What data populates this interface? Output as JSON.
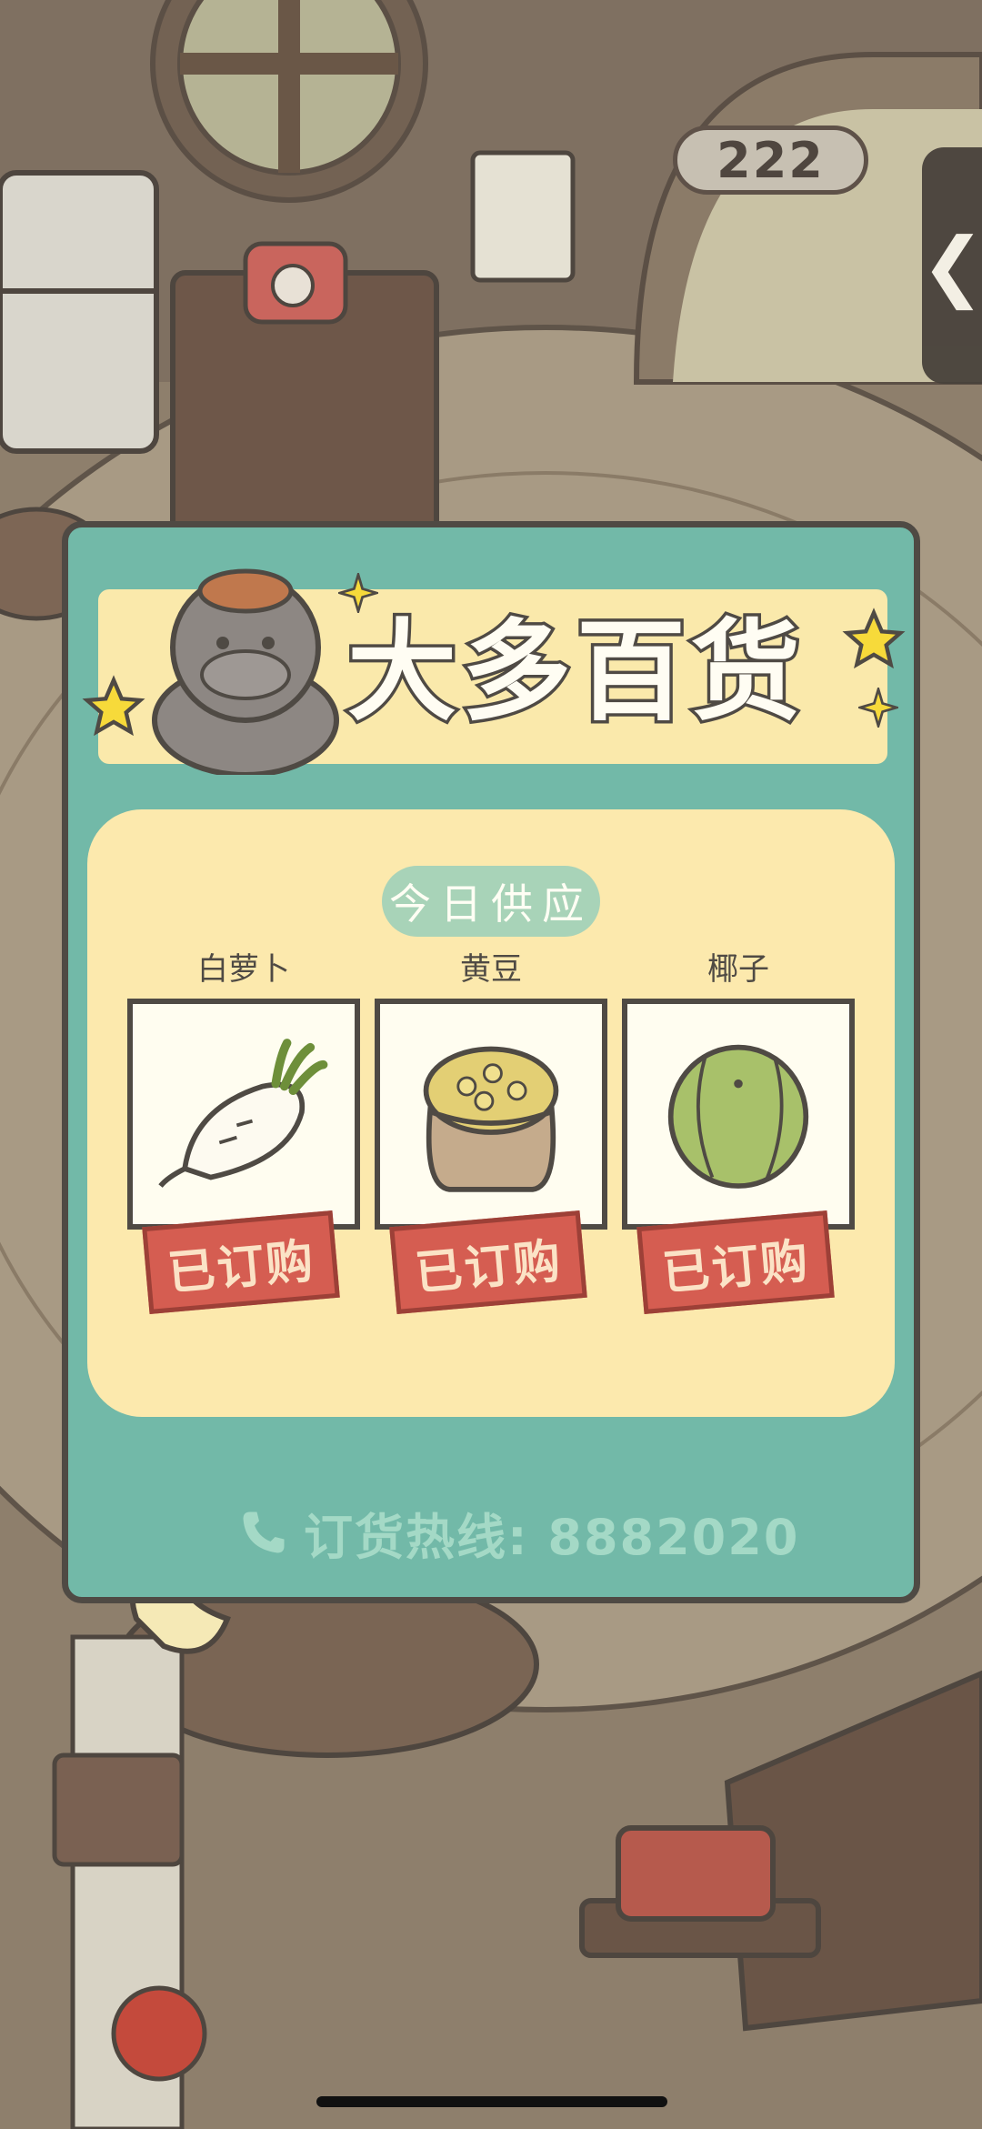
{
  "hud": {
    "counter": "222",
    "side_tab_glyph": "❮"
  },
  "shop": {
    "title": "大多百货",
    "section_title": "今日供应",
    "items": [
      {
        "name": "白萝卜",
        "status": "已订购",
        "icon": "daikon-icon"
      },
      {
        "name": "黄豆",
        "status": "已订购",
        "icon": "soybean-sack-icon"
      },
      {
        "name": "椰子",
        "status": "已订购",
        "icon": "coconut-icon"
      }
    ],
    "hotline": "订货热线: 8882020"
  },
  "colors": {
    "panel": "#72b9a8",
    "banner": "#fae9ab",
    "stamp": "#d55d51",
    "outline": "#4f4a44"
  }
}
